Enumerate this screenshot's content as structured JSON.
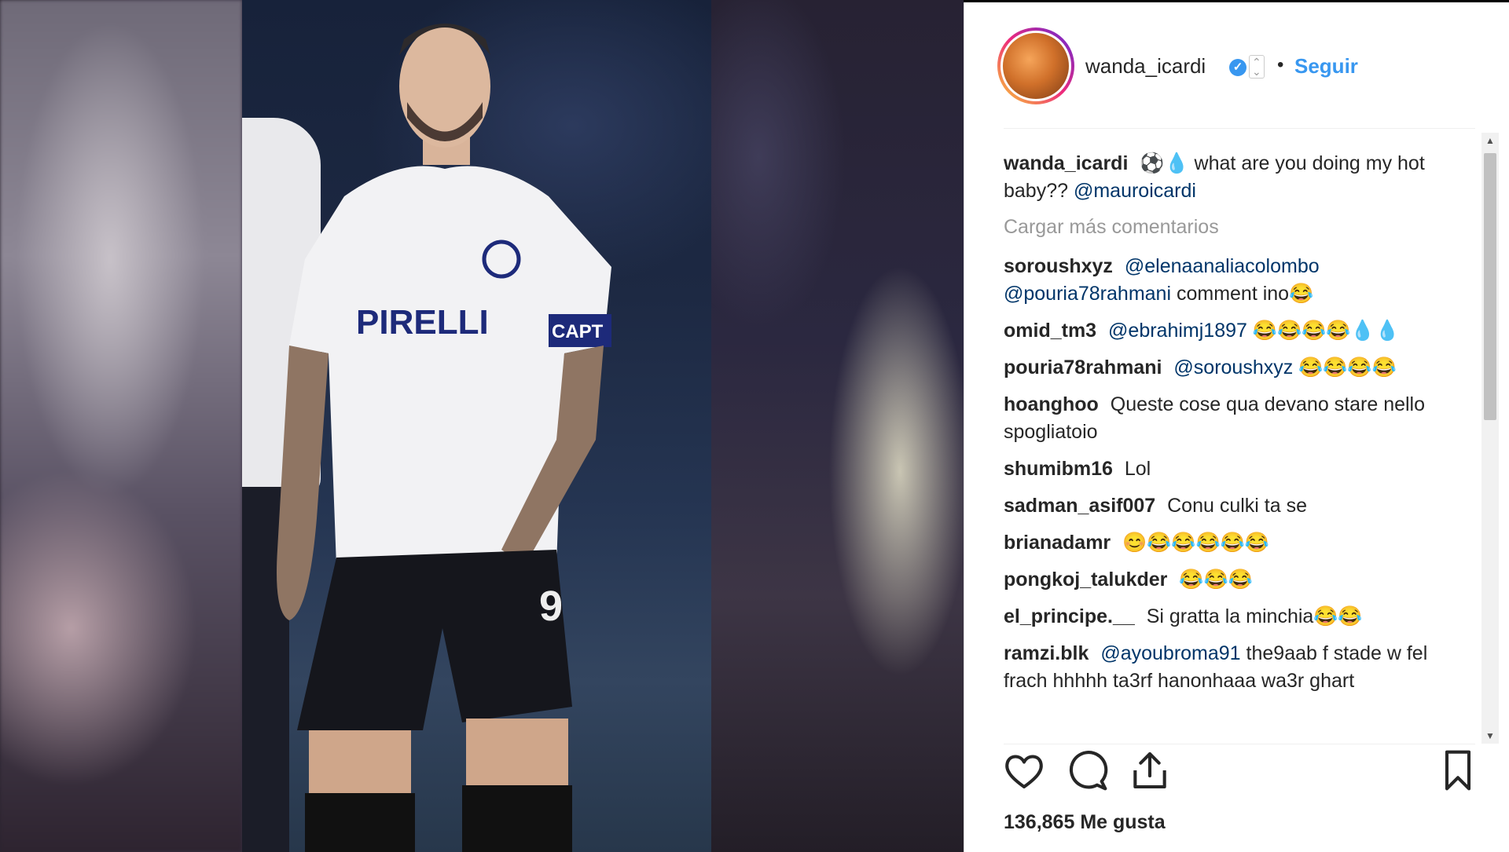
{
  "post": {
    "username": "wanda_icardi",
    "follow_label": "Seguir",
    "separator": "•",
    "verified_glyph": "✓",
    "caption": {
      "username": "wanda_icardi",
      "text": "⚽💧 what are you doing my hot baby?? ",
      "mention": "@mauroicardi"
    },
    "load_more_label": "Cargar más comentarios",
    "comments": [
      {
        "user": "soroushxyz",
        "mention": "@elenaanaliacolombo @pouria78rahmani",
        "text": " comment ino😂"
      },
      {
        "user": "omid_tm3",
        "mention": "@ebrahimj1897",
        "text": " 😂😂😂😂💧💧"
      },
      {
        "user": "pouria78rahmani",
        "mention": "@soroushxyz",
        "text": " 😂😂😂😂"
      },
      {
        "user": "hoanghoo",
        "mention": "",
        "text": "Queste cose qua devano stare nello spogliatoio"
      },
      {
        "user": "shumibm16",
        "mention": "",
        "text": "Lol"
      },
      {
        "user": "sadman_asif007",
        "mention": "",
        "text": "Conu culki ta se"
      },
      {
        "user": "brianadamr",
        "mention": "",
        "text": "😊😂😂😂😂😂"
      },
      {
        "user": "pongkoj_talukder",
        "mention": "",
        "text": "😂😂😂"
      },
      {
        "user": "el_principe.__",
        "mention": "",
        "text": "Si gratta la minchia😂😂"
      },
      {
        "user": "ramzi.blk",
        "mention": "@ayoubroma91",
        "text": " the9aab f stade w fel frach hhhhh ta3rf hanonhaaa wa3r ghart"
      }
    ],
    "likes_label": "136,865 Me gusta"
  },
  "icons": {
    "like": "heart-icon",
    "comment": "comment-bubble-icon",
    "share": "share-icon",
    "save": "bookmark-icon"
  },
  "scroll": {
    "up": "▲",
    "down": "▼"
  },
  "colors": {
    "link": "#3897f0",
    "mention": "#003569",
    "muted": "#999999",
    "text": "#262626"
  }
}
